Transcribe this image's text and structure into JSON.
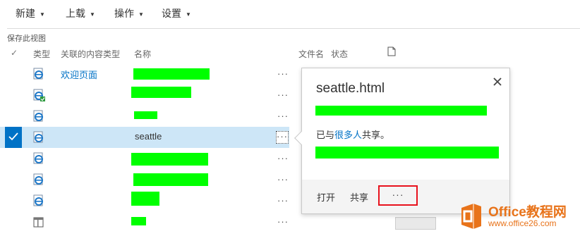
{
  "toolbar": {
    "new_label": "新建",
    "upload_label": "上载",
    "actions_label": "操作",
    "settings_label": "设置"
  },
  "save_view_label": "保存此视图",
  "columns": {
    "type": "类型",
    "content_type": "关联的内容类型",
    "name": "名称",
    "file_name": "文件名",
    "status": "状态"
  },
  "rows": [
    {
      "icon": "ie-html-icon",
      "content_type": "欢迎页面",
      "name": "",
      "selected": false
    },
    {
      "icon": "ie-html-check-icon",
      "content_type": "",
      "name": "",
      "selected": false
    },
    {
      "icon": "ie-html-icon",
      "content_type": "",
      "name": "",
      "selected": false
    },
    {
      "icon": "ie-html-icon",
      "content_type": "",
      "name": "seattle",
      "selected": true
    },
    {
      "icon": "ie-html-icon",
      "content_type": "",
      "name": "",
      "selected": false
    },
    {
      "icon": "ie-html-icon",
      "content_type": "",
      "name": "",
      "selected": false
    },
    {
      "icon": "ie-html-icon",
      "content_type": "",
      "name": "",
      "selected": false
    },
    {
      "icon": "page-layout-icon",
      "content_type": "",
      "name": "",
      "selected": false
    }
  ],
  "callout": {
    "title": "seattle.html",
    "shared_prefix": "已与",
    "shared_link": "很多人",
    "shared_suffix": "共享。",
    "open_label": "打开",
    "share_label": "共享",
    "more_label": "···"
  },
  "watermark": {
    "brand": "Office教程网",
    "url": "www.office26.com"
  },
  "colors": {
    "accent": "#0072c6",
    "selected_row": "#cde6f7",
    "highlight_box": "#e8121d",
    "redaction": "#00ff00",
    "watermark": "#e8731a"
  }
}
